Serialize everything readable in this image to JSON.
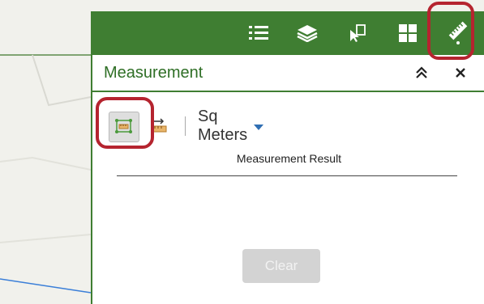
{
  "toolbar": {
    "icons": [
      "legend-list-icon",
      "layers-icon",
      "select-pointer-icon",
      "grid-apps-icon",
      "ruler-measure-icon"
    ],
    "active": "ruler-measure-icon"
  },
  "panel": {
    "title": "Measurement",
    "collapse_icon": "double-chevron-up-icon",
    "close_icon": "close-icon"
  },
  "measurement": {
    "tools": [
      "area-measure-icon",
      "distance-measure-icon"
    ],
    "active_tool": "area-measure-icon",
    "unit": "Sq Meters",
    "result_header": "Measurement Result",
    "clear_label": "Clear",
    "clear_enabled": false
  },
  "colors": {
    "toolbar_green": "#3f7e32",
    "title_green": "#2f6f26",
    "highlight_red": "#b5242f",
    "dropdown_caret": "#2f6fb3"
  }
}
